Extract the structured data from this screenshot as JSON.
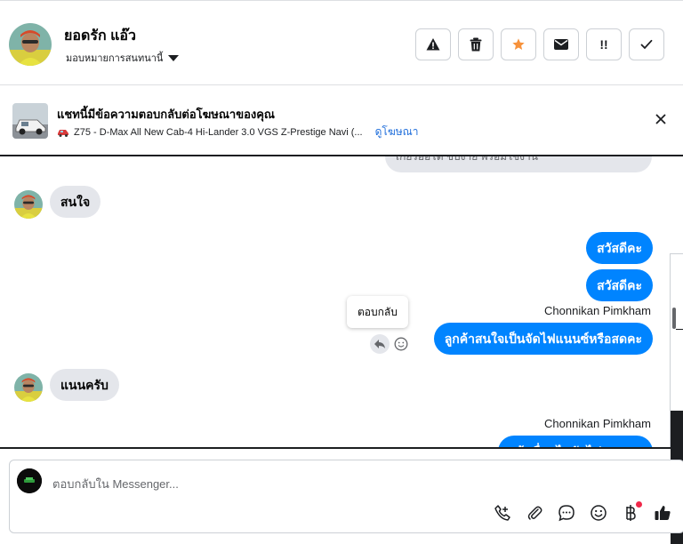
{
  "header": {
    "contact_name": "ยอดรัก แอ๊ว",
    "assign_label": "มอบหมายการสนทนานี้",
    "actions": [
      {
        "name": "report",
        "label": "⚠"
      },
      {
        "name": "delete",
        "label": "🗑"
      },
      {
        "name": "star",
        "label": "★"
      },
      {
        "name": "mark-unread",
        "label": "✉"
      },
      {
        "name": "follow-up",
        "label": "!!"
      },
      {
        "name": "done",
        "label": "✓"
      }
    ]
  },
  "ad_banner": {
    "title": "แชทนี้มีข้อความตอบกลับต่อโฆษณาของคุณ",
    "subtitle": "Z75 - D-Max All New Cab-4 Hi-Lander 3.0 VGS Z-Prestige Navi (...",
    "link": "ดูโฆษณา"
  },
  "messages": {
    "partial_top": "เกียร์ออโต้ ขับง่าย พร้อมใช้งาน",
    "in_1": "สนใจ",
    "out_1": "สวัสดีคะ",
    "out_2": "สวัสดีคะ",
    "sender_1": "Chonnikan Pimkham",
    "out_3": "ลูกค้าสนใจเป็นจัดไฟแนนซ์หรือสดคะ",
    "tooltip": "ตอบกลับ",
    "in_2": "แนนครับ",
    "sender_2": "Chonnikan Pimkham",
    "out_partial": "แจ้งเงื่อนไขจัดไฟ"
  },
  "composer": {
    "placeholder": "ตอบกลับใน Messenger...",
    "tools": [
      "call-plus-icon",
      "paperclip-icon",
      "chat-bubble-icon",
      "emoji-icon",
      "baht-icon",
      "thumbs-up-icon"
    ]
  },
  "colors": {
    "accent": "#0084ff",
    "incoming_bubble": "#e4e6eb",
    "link": "#216fdb",
    "star": "#f7923b",
    "notif": "#f02849"
  }
}
